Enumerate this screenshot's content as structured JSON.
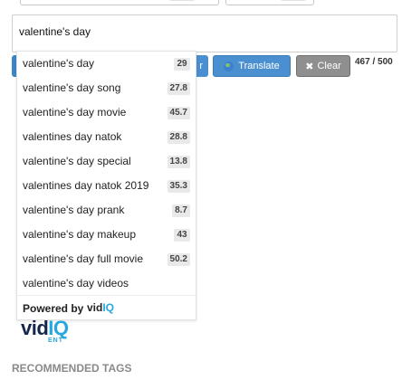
{
  "tag_input": {
    "value": "valentine's day"
  },
  "toolbar": {
    "partial_label": "r",
    "translate_label": "Translate",
    "clear_label": "Clear",
    "clear_icon": "✖",
    "counter": "467 / 500"
  },
  "suggestions": [
    {
      "label": "valentine's day",
      "score": "29"
    },
    {
      "label": "valentine's day song",
      "score": "27.8"
    },
    {
      "label": "valentine's day movie",
      "score": "45.7"
    },
    {
      "label": "valentines day natok",
      "score": "28.8"
    },
    {
      "label": "valentine's day special",
      "score": "13.8"
    },
    {
      "label": "valentines day natok 2019",
      "score": "35.3"
    },
    {
      "label": "valentine's day prank",
      "score": "8.7"
    },
    {
      "label": "valentine's day makeup",
      "score": "43"
    },
    {
      "label": "valentine's day full movie",
      "score": "50.2"
    },
    {
      "label": "valentine's day videos",
      "score": ""
    }
  ],
  "powered_by": {
    "text": "Powered by",
    "brand_a": "vid",
    "brand_b": "IQ"
  },
  "logo": {
    "part_a": "vid",
    "part_b": "IQ",
    "sub": "ENT"
  },
  "section": {
    "recommended_tags": "RECOMMENDED TAGS"
  },
  "colors": {
    "accent": "#4a90d0",
    "brand_blue": "#27a7df",
    "brand_navy": "#15254b",
    "clear_gray": "#8f8f8f"
  }
}
